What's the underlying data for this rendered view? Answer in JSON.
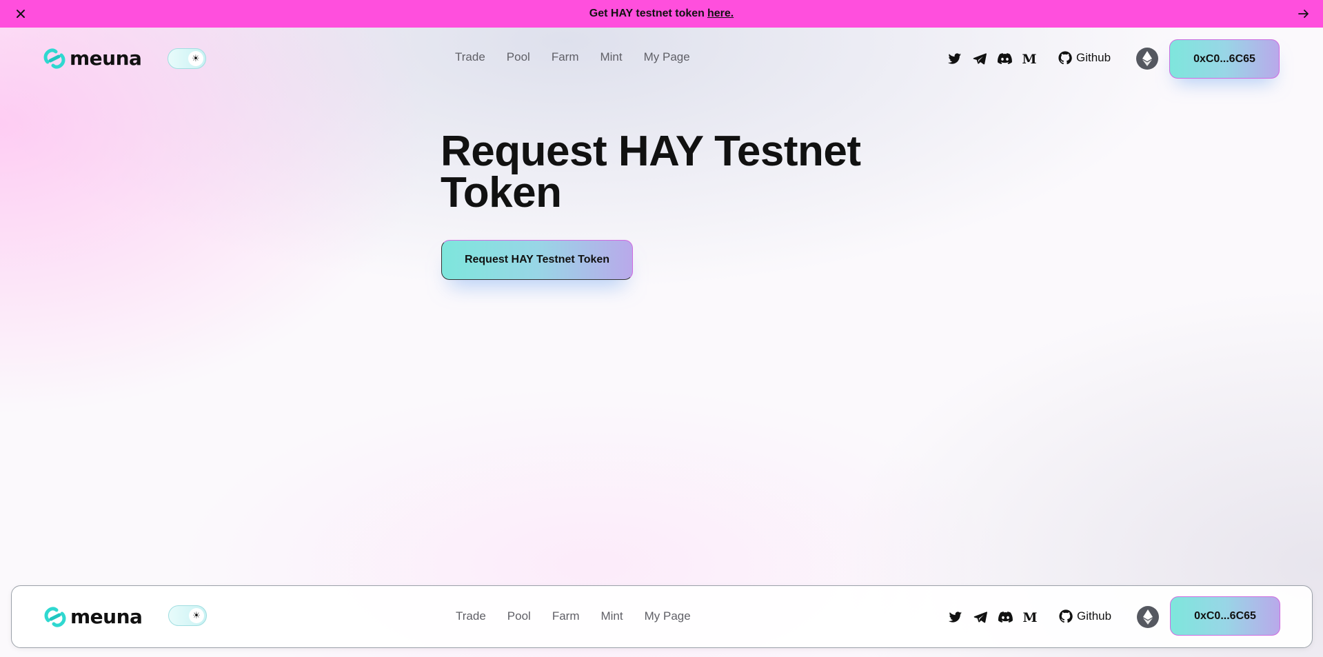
{
  "banner": {
    "text": "Get HAY testnet token",
    "link": "here.",
    "close_icon": "close-icon",
    "arrow_icon": "arrow-right-icon",
    "color": "#ff4fdd"
  },
  "header": {
    "logo_text": "meuna",
    "theme_icon": "sun-icon",
    "nav": [
      "Trade",
      "Pool",
      "Farm",
      "Mint",
      "My Page"
    ],
    "social_icons": [
      "twitter-icon",
      "telegram-icon",
      "discord-icon",
      "medium-icon"
    ],
    "github_label": "Github",
    "network_icon": "ethereum-icon",
    "wallet_address": "0xC0...6C65"
  },
  "hero": {
    "title": "Request HAY Testnet Token",
    "button_label": "Request HAY Testnet Token"
  },
  "colors": {
    "accent_gradient": [
      "#7ee6dc",
      "#b9a9ea"
    ],
    "border_pink": "#cf6be0",
    "logo_teal": "#2fd8d0"
  }
}
